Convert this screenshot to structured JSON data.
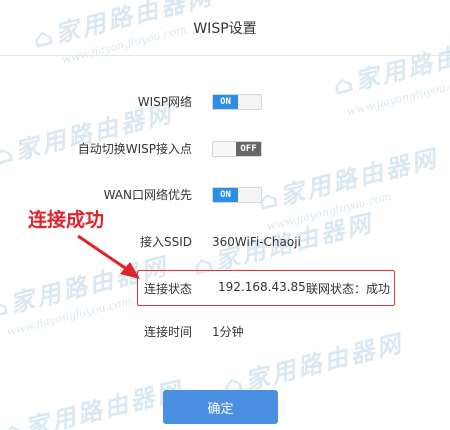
{
  "header": {
    "title": "WISP设置"
  },
  "rows": {
    "wisp": {
      "label": "WISP网络",
      "toggle": "ON"
    },
    "auto_switch": {
      "label": "自动切换WISP接入点",
      "toggle": "OFF"
    },
    "wan_priority": {
      "label": "WAN口网络优先",
      "toggle": "ON"
    },
    "ssid": {
      "label": "接入SSID",
      "value": "360WiFi-Chaoji"
    },
    "status": {
      "label": "连接状态",
      "ip": "192.168.43.85",
      "network": "联网状态：成功"
    },
    "time": {
      "label": "连接时间",
      "value": "1分钟"
    }
  },
  "annotation": {
    "text": "连接成功"
  },
  "confirm_label": "确定",
  "watermark": {
    "cn": "家用路由器网",
    "url": "www.jiayongluyou.com"
  },
  "colors": {
    "toggle_on": "#2c8ee4",
    "toggle_off": "#666666",
    "highlight": "#e0343b",
    "button": "#4a90e2"
  }
}
